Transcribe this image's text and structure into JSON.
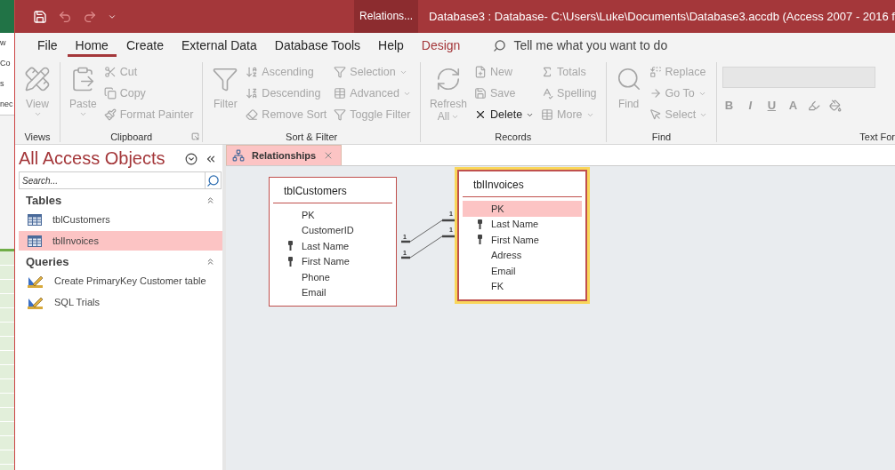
{
  "background_window": {
    "texts": [
      "w",
      "Co",
      "s",
      "nec"
    ]
  },
  "window": {
    "context_tab": "Relations...",
    "title": "Database3 : Database- C:\\Users\\Luke\\Documents\\Database3.accdb (Access 2007 - 2016 f"
  },
  "menu_tabs": [
    {
      "label": "File",
      "selected": false,
      "kind": "plain"
    },
    {
      "label": "Home",
      "selected": true,
      "kind": "plain"
    },
    {
      "label": "Create",
      "selected": false,
      "kind": "plain"
    },
    {
      "label": "External Data",
      "selected": false,
      "kind": "plain"
    },
    {
      "label": "Database Tools",
      "selected": false,
      "kind": "plain"
    },
    {
      "label": "Help",
      "selected": false,
      "kind": "plain"
    },
    {
      "label": "Design",
      "selected": false,
      "kind": "contextual"
    }
  ],
  "tell_me": {
    "placeholder": "Tell me what you want to do"
  },
  "ribbon_groups": [
    {
      "label": "Views",
      "launcher": false,
      "columns": [
        [
          {
            "label": "View",
            "kind": "large",
            "dropdown": true,
            "disabled": true
          }
        ]
      ]
    },
    {
      "label": "Clipboard",
      "launcher": true,
      "columns": [
        [
          {
            "label": "Paste",
            "kind": "large",
            "dropdown": true,
            "disabled": true
          }
        ],
        [
          {
            "label": "Cut",
            "kind": "small",
            "dropdown": false,
            "disabled": true
          },
          {
            "label": "Copy",
            "kind": "small",
            "dropdown": false,
            "disabled": true
          },
          {
            "label": "Format Painter",
            "kind": "small",
            "dropdown": false,
            "disabled": true
          }
        ]
      ]
    },
    {
      "label": "Sort & Filter",
      "launcher": false,
      "columns": [
        [
          {
            "label": "Filter",
            "kind": "large",
            "dropdown": false,
            "disabled": true
          }
        ],
        [
          {
            "label": "Ascending",
            "kind": "small",
            "dropdown": false,
            "disabled": true
          },
          {
            "label": "Descending",
            "kind": "small",
            "dropdown": false,
            "disabled": true
          },
          {
            "label": "Remove Sort",
            "kind": "small",
            "dropdown": false,
            "disabled": true
          }
        ],
        [
          {
            "label": "Selection",
            "kind": "small",
            "dropdown": true,
            "disabled": true
          },
          {
            "label": "Advanced",
            "kind": "small",
            "dropdown": true,
            "disabled": true
          },
          {
            "label": "Toggle Filter",
            "kind": "small",
            "dropdown": false,
            "disabled": true
          }
        ]
      ]
    },
    {
      "label": "Records",
      "launcher": false,
      "columns": [
        [
          {
            "label": "Refresh",
            "sublabel": "All",
            "kind": "large",
            "dropdown": true,
            "disabled": true
          }
        ],
        [
          {
            "label": "New",
            "kind": "small",
            "dropdown": false,
            "disabled": true
          },
          {
            "label": "Save",
            "kind": "small",
            "dropdown": false,
            "disabled": true
          },
          {
            "label": "Delete",
            "kind": "small",
            "dropdown": true,
            "disabled": false
          }
        ],
        [
          {
            "label": "Totals",
            "kind": "small",
            "dropdown": false,
            "disabled": true
          },
          {
            "label": "Spelling",
            "kind": "small",
            "dropdown": false,
            "disabled": true
          },
          {
            "label": "More",
            "kind": "small",
            "dropdown": true,
            "disabled": true
          }
        ]
      ]
    },
    {
      "label": "Find",
      "launcher": false,
      "columns": [
        [
          {
            "label": "Find",
            "kind": "large",
            "dropdown": false,
            "disabled": true
          }
        ],
        [
          {
            "label": "Replace",
            "kind": "small",
            "dropdown": false,
            "disabled": true
          },
          {
            "label": "Go To",
            "kind": "small",
            "dropdown": true,
            "disabled": true
          },
          {
            "label": "Select",
            "kind": "small",
            "dropdown": true,
            "disabled": true
          }
        ]
      ]
    }
  ],
  "text_formatting": {
    "label": "Text For",
    "buttons": [
      "B",
      "I",
      "U",
      "A"
    ]
  },
  "nav_pane": {
    "title": "All Access Objects",
    "search": {
      "placeholder": "Search..."
    },
    "sections": [
      {
        "label": "Tables",
        "expanded": true,
        "items": [
          {
            "label": "tblCustomers",
            "kind": "table",
            "selected": false
          },
          {
            "label": "tblInvoices",
            "kind": "table",
            "selected": true
          }
        ]
      },
      {
        "label": "Queries",
        "expanded": true,
        "items": [
          {
            "label": "Create PrimaryKey Customer table",
            "kind": "query",
            "selected": false
          },
          {
            "label": "SQL Trials",
            "kind": "query",
            "selected": false
          }
        ]
      }
    ]
  },
  "document_tabs": [
    {
      "label": "Relationships",
      "selected": true
    }
  ],
  "diagram": {
    "tables": [
      {
        "title": "tblCustomers",
        "selected": false,
        "fields": [
          {
            "name": "PK",
            "key": false,
            "selected": false
          },
          {
            "name": "CustomerID",
            "key": false,
            "selected": false
          },
          {
            "name": "Last Name",
            "key": true,
            "selected": false
          },
          {
            "name": "First Name",
            "key": true,
            "selected": false
          },
          {
            "name": "Phone",
            "key": false,
            "selected": false
          },
          {
            "name": "Email",
            "key": false,
            "selected": false
          }
        ]
      },
      {
        "title": "tblInvoices",
        "selected": true,
        "fields": [
          {
            "name": "PK",
            "key": false,
            "selected": true
          },
          {
            "name": "Last Name",
            "key": true,
            "selected": false
          },
          {
            "name": "First Name",
            "key": true,
            "selected": false
          },
          {
            "name": "Adress",
            "key": false,
            "selected": false
          },
          {
            "name": "Email",
            "key": false,
            "selected": false
          },
          {
            "name": "FK",
            "key": false,
            "selected": false
          }
        ]
      }
    ],
    "relationships": [
      {
        "from_label": "1",
        "to_label": "1"
      },
      {
        "from_label": "1",
        "to_label": "1"
      }
    ]
  }
}
